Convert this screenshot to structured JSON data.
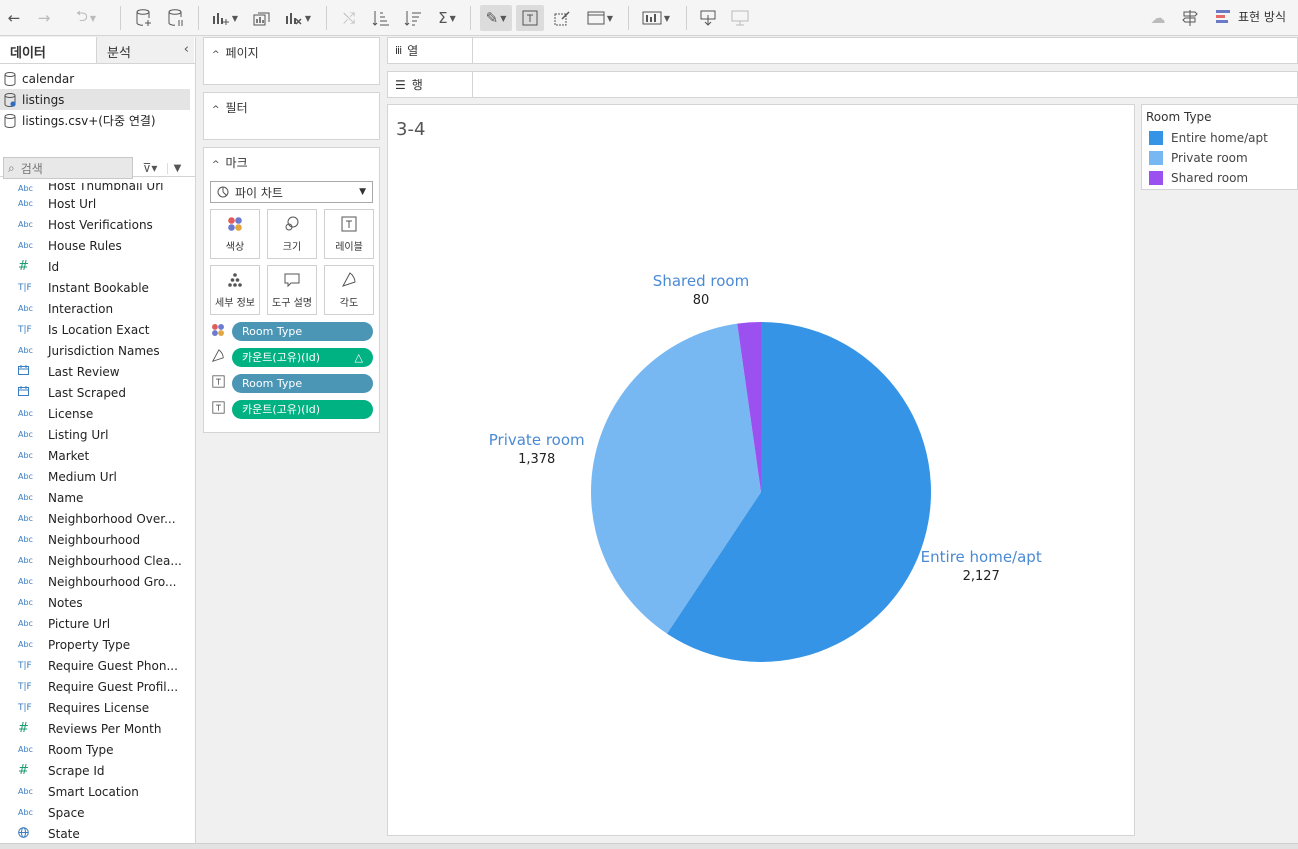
{
  "toolbar": {
    "show_me_label": "표현 방식"
  },
  "data_pane": {
    "tab_data": "데이터",
    "tab_analytics": "분석",
    "datasources": [
      {
        "name": "calendar",
        "selected": false
      },
      {
        "name": "listings",
        "selected": true
      },
      {
        "name": "listings.csv+(다중 연결)",
        "selected": false
      }
    ],
    "search_placeholder": "검색",
    "fields": [
      {
        "type": "Abc",
        "name": "Host Thumbnail Url"
      },
      {
        "type": "Abc",
        "name": "Host Url"
      },
      {
        "type": "Abc",
        "name": "Host Verifications"
      },
      {
        "type": "Abc",
        "name": "House Rules"
      },
      {
        "type": "#",
        "name": "Id"
      },
      {
        "type": "T|F",
        "name": "Instant Bookable"
      },
      {
        "type": "Abc",
        "name": "Interaction"
      },
      {
        "type": "T|F",
        "name": "Is Location Exact"
      },
      {
        "type": "Abc",
        "name": "Jurisdiction Names"
      },
      {
        "type": "date",
        "name": "Last Review"
      },
      {
        "type": "date",
        "name": "Last Scraped"
      },
      {
        "type": "Abc",
        "name": "License"
      },
      {
        "type": "Abc",
        "name": "Listing Url"
      },
      {
        "type": "Abc",
        "name": "Market"
      },
      {
        "type": "Abc",
        "name": "Medium Url"
      },
      {
        "type": "Abc",
        "name": "Name"
      },
      {
        "type": "Abc",
        "name": "Neighborhood Over..."
      },
      {
        "type": "Abc",
        "name": "Neighbourhood"
      },
      {
        "type": "Abc",
        "name": "Neighbourhood Clea..."
      },
      {
        "type": "Abc",
        "name": "Neighbourhood Gro..."
      },
      {
        "type": "Abc",
        "name": "Notes"
      },
      {
        "type": "Abc",
        "name": "Picture Url"
      },
      {
        "type": "Abc",
        "name": "Property Type"
      },
      {
        "type": "T|F",
        "name": "Require Guest Phon..."
      },
      {
        "type": "T|F",
        "name": "Require Guest Profil..."
      },
      {
        "type": "T|F",
        "name": "Requires License"
      },
      {
        "type": "#",
        "name": "Reviews Per Month"
      },
      {
        "type": "Abc",
        "name": "Room Type"
      },
      {
        "type": "#",
        "name": "Scrape Id"
      },
      {
        "type": "Abc",
        "name": "Smart Location"
      },
      {
        "type": "Abc",
        "name": "Space"
      },
      {
        "type": "geo",
        "name": "State"
      }
    ]
  },
  "cards": {
    "pages_title": "페이지",
    "filters_title": "필터",
    "marks_title": "마크",
    "mark_type": "파이 차트",
    "mark_buttons": [
      {
        "label": "색상",
        "icon": "color-icon"
      },
      {
        "label": "크기",
        "icon": "size-icon"
      },
      {
        "label": "레이블",
        "icon": "label-icon"
      },
      {
        "label": "세부 정보",
        "icon": "detail-icon"
      },
      {
        "label": "도구 설명",
        "icon": "tooltip-icon"
      },
      {
        "label": "각도",
        "icon": "angle-icon"
      }
    ],
    "pills": [
      {
        "encoding": "color",
        "label": "Room Type",
        "kind": "dimension",
        "suffix": ""
      },
      {
        "encoding": "angle",
        "label": "카운트(고유)(Id)",
        "kind": "measure",
        "suffix": "△"
      },
      {
        "encoding": "label",
        "label": "Room Type",
        "kind": "dimension",
        "suffix": ""
      },
      {
        "encoding": "label",
        "label": "카운트(고유)(Id)",
        "kind": "measure",
        "suffix": ""
      }
    ]
  },
  "shelves": {
    "columns_label": "열",
    "rows_label": "행"
  },
  "sheet": {
    "title": "3-4"
  },
  "legend": {
    "title": "Room Type",
    "items": [
      {
        "label": "Entire home/apt",
        "color": "#3594e6"
      },
      {
        "label": "Private room",
        "color": "#78b8f2"
      },
      {
        "label": "Shared room",
        "color": "#9b50f0"
      }
    ]
  },
  "chart_data": {
    "type": "pie",
    "categories": [
      "Entire home/apt",
      "Private room",
      "Shared room"
    ],
    "values": [
      2127,
      1378,
      80
    ],
    "value_labels": [
      "2,127",
      "1,378",
      "80"
    ],
    "colors": [
      "#3594e6",
      "#78b8f2",
      "#9b50f0"
    ],
    "title": "3-4"
  }
}
